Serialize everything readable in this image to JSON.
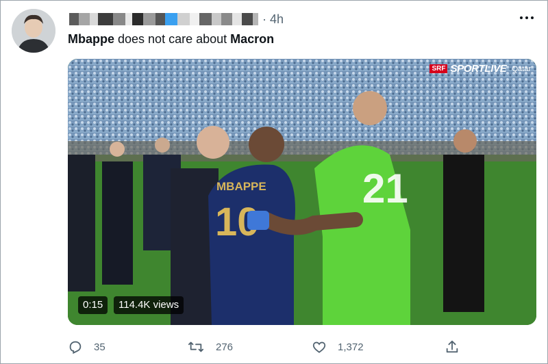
{
  "tweet": {
    "time": "· 4h",
    "text_parts": {
      "name1": "Mbappe",
      "middle": " does not care about ",
      "name2": "Macron"
    },
    "more_icon": "more-options-icon"
  },
  "media": {
    "duration": "0:15",
    "views": "114.4K views",
    "watermark": {
      "brand_badge": "SRF",
      "brand": "SPORTLIVE",
      "extra": "Qatar"
    },
    "jerseys": {
      "player1_name": "MBAPPE",
      "player1_number": "10",
      "player2_number": "21"
    }
  },
  "actions": [
    {
      "icon": "reply-icon",
      "count": "35"
    },
    {
      "icon": "retweet-icon",
      "count": "276"
    },
    {
      "icon": "like-icon",
      "count": "1,372"
    },
    {
      "icon": "share-icon",
      "count": ""
    }
  ],
  "colors": {
    "text": "#0f1419",
    "muted": "#536471",
    "pitch": "#3d7d2c",
    "france_blue": "#1c2f6b",
    "keeper_green": "#5ed33b"
  }
}
